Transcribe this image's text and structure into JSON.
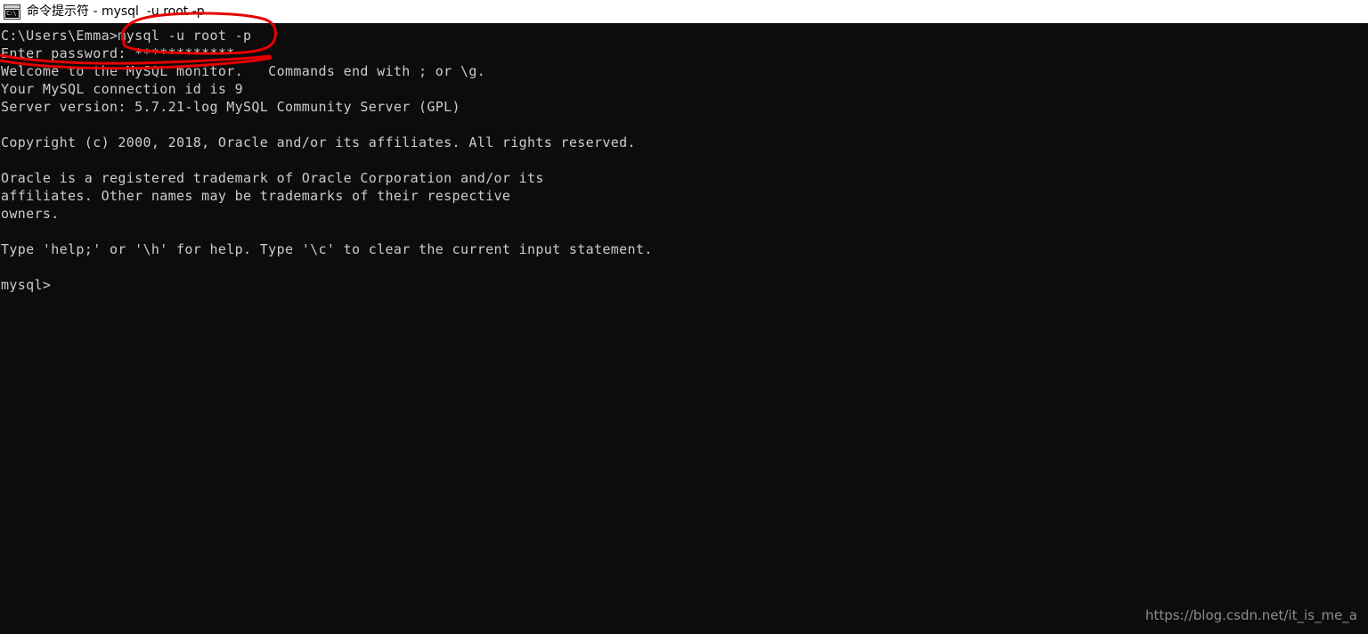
{
  "window": {
    "titlebar": {
      "icon": "cmd-icon",
      "icon_text": "C:\\",
      "title": "命令提示符 - mysql  -u root -p",
      "background_color": "#ffffff",
      "text_color": "#000000"
    },
    "terminal": {
      "background_color": "#0c0c0c",
      "text_color": "#cccccc",
      "font_size_px": 15,
      "line_height_px": 20,
      "lines": [
        "C:\\Users\\Emma>mysql -u root -p",
        "Enter password: ************",
        "Welcome to the MySQL monitor.   Commands end with ; or \\g.",
        "Your MySQL connection id is 9",
        "Server version: 5.7.21-log MySQL Community Server (GPL)",
        "",
        "Copyright (c) 2000, 2018, Oracle and/or its affiliates. All rights reserved.",
        "",
        "Oracle is a registered trademark of Oracle Corporation and/or its",
        "affiliates. Other names may be trademarks of their respective",
        "owners.",
        "",
        "Type 'help;' or '\\h' for help. Type '\\c' to clear the current input statement.",
        "",
        "mysql>"
      ]
    }
  },
  "annotations": {
    "color": "#e60000",
    "stroke_width": 3,
    "items": [
      {
        "name": "ellipse-around-mysql-command",
        "shape": "ellipse",
        "label": "mysql -u root -p"
      },
      {
        "name": "underline-under-password",
        "shape": "curved-underline",
        "label": "Enter password: ************"
      }
    ]
  },
  "watermark": {
    "text": "https://blog.csdn.net/it_is_me_a",
    "color": "#8c8c8c"
  }
}
